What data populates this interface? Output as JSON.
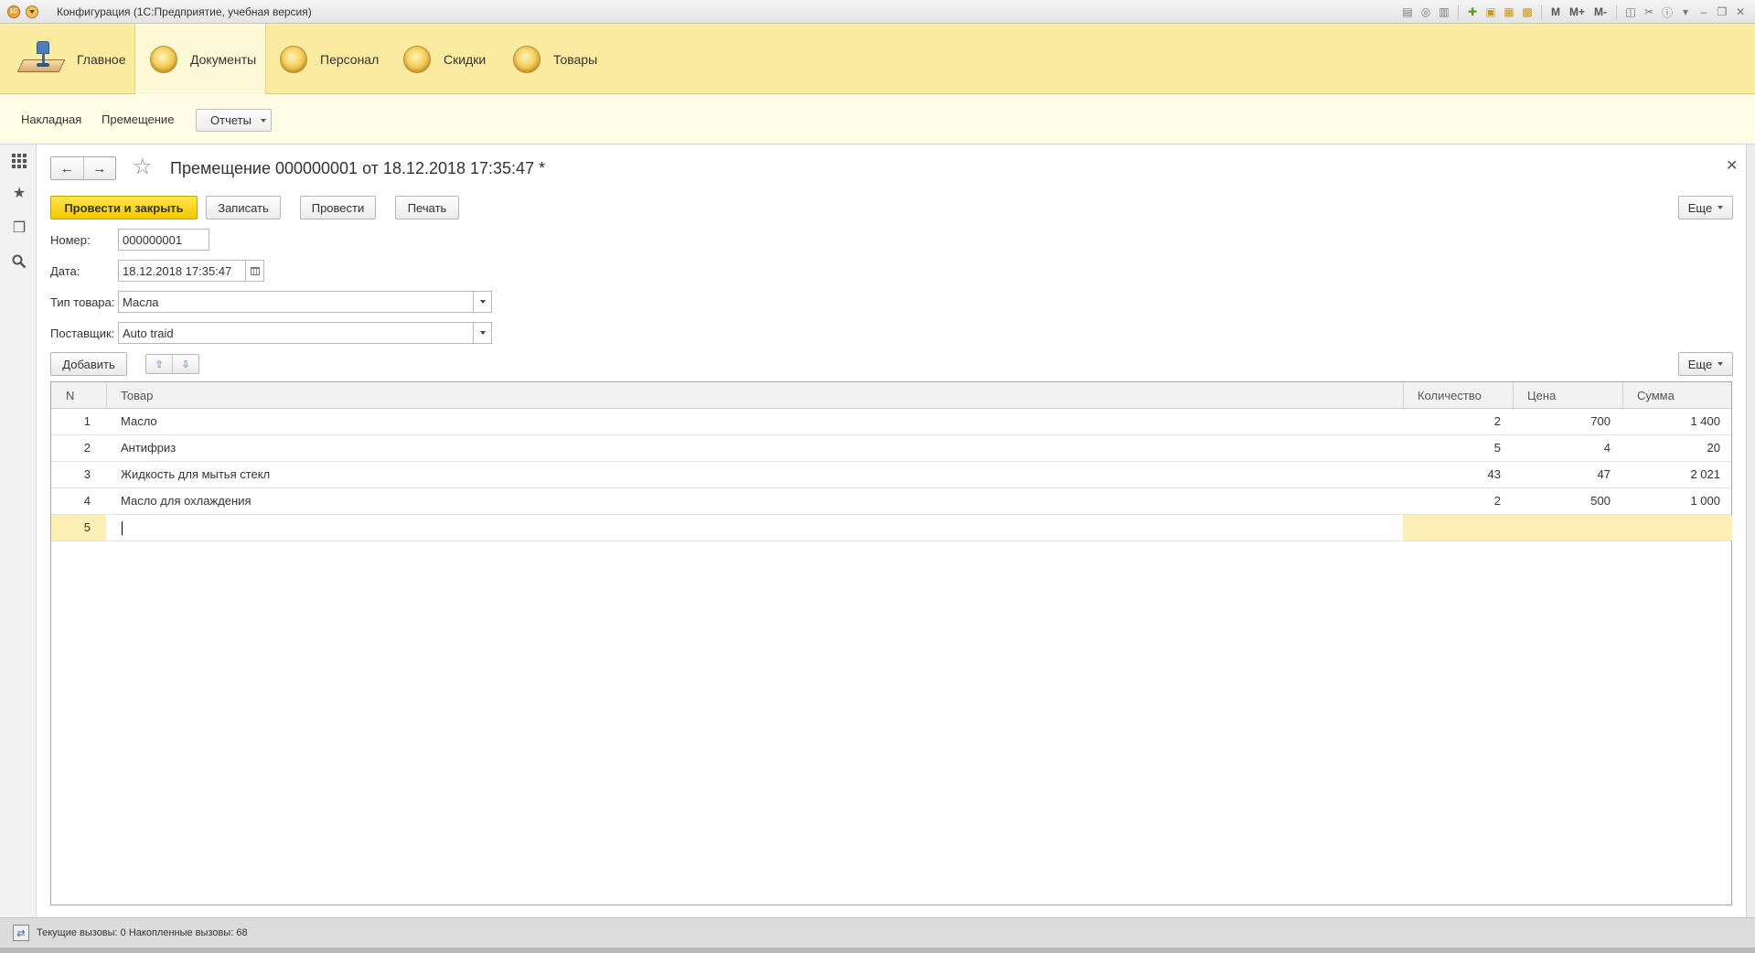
{
  "window": {
    "title": "Конфигурация  (1С:Предприятие, учебная версия)",
    "logo_text": "1С",
    "toolbar_m": "M",
    "toolbar_mplus": "M+",
    "toolbar_mminus": "M-"
  },
  "sections": [
    {
      "label": "Главное",
      "icon": "home-icon"
    },
    {
      "label": "Документы",
      "icon": "coin-icon",
      "active": true
    },
    {
      "label": "Персонал",
      "icon": "coin-icon"
    },
    {
      "label": "Скидки",
      "icon": "coin-icon"
    },
    {
      "label": "Товары",
      "icon": "coin-icon"
    }
  ],
  "submenu": {
    "link1": "Накладная",
    "link2": "Премещение",
    "reports": "Отчеты"
  },
  "document": {
    "title": "Премещение 000000001 от 18.12.2018 17:35:47 *",
    "buttons": {
      "post_close": "Провести и закрыть",
      "save": "Записать",
      "post": "Провести",
      "print": "Печать",
      "more": "Еще"
    },
    "fields": {
      "number_label": "Номер:",
      "number_value": "000000001",
      "date_label": "Дата:",
      "date_value": "18.12.2018 17:35:47",
      "type_label": "Тип товара:",
      "type_value": "Масла",
      "supplier_label": "Поставщик:",
      "supplier_value": "Auto traid"
    },
    "table_toolbar": {
      "add": "Добавить",
      "more": "Еще"
    },
    "table": {
      "columns": [
        "N",
        "Товар",
        "Количество",
        "Цена",
        "Сумма"
      ],
      "rows": [
        {
          "n": "1",
          "item": "Масло",
          "qty": "2",
          "price": "700",
          "sum": "1 400"
        },
        {
          "n": "2",
          "item": "Антифриз",
          "qty": "5",
          "price": "4",
          "sum": "20"
        },
        {
          "n": "3",
          "item": "Жидкость для мытья стекл",
          "qty": "43",
          "price": "47",
          "sum": "2 021"
        },
        {
          "n": "4",
          "item": "Масло для охлаждения",
          "qty": "2",
          "price": "500",
          "sum": "1 000"
        },
        {
          "n": "5",
          "item": "",
          "qty": "",
          "price": "",
          "sum": ""
        }
      ]
    }
  },
  "status": {
    "text": "Текущие вызовы: 0   Накопленные вызовы: 68"
  },
  "colors": {
    "section_bg": "#faeba0",
    "submenu_bg": "#fffde3",
    "primary_button": "#f5c800",
    "active_row": "#fcefb2"
  }
}
